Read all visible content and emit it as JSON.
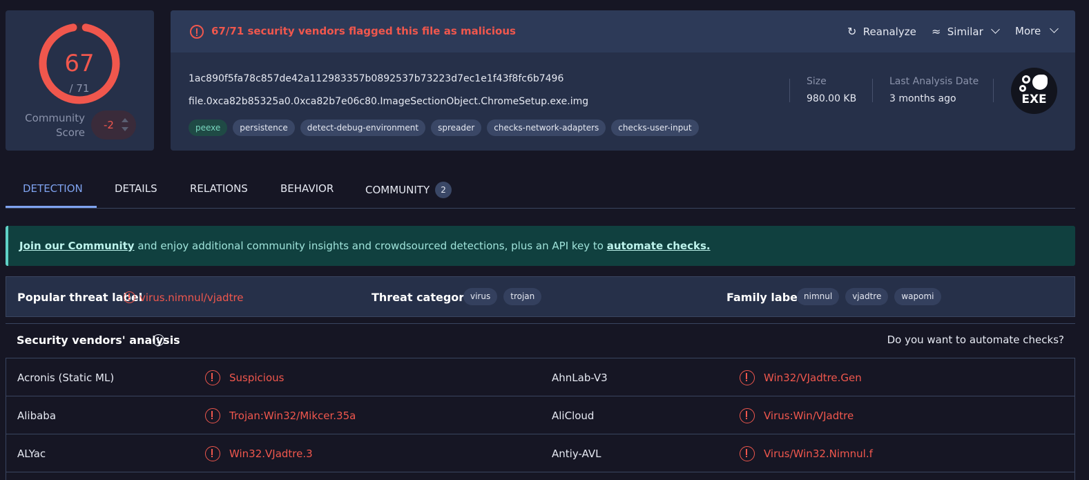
{
  "score": {
    "detected": "67",
    "total": "/ 71",
    "fraction": 0.944,
    "color": "#f0574d"
  },
  "community": {
    "label_line1": "Community",
    "label_line2": "Score",
    "value": "-2"
  },
  "file": {
    "alert": "67/71 security vendors flagged this file as malicious",
    "hash": "1ac890f5fa78c857de42a112983357b0892537b73223d7ec1e1f43f8fc6b7496",
    "name": "file.0xca82b85325a0.0xca82b7e06c80.ImageSectionObject.ChromeSetup.exe.img",
    "tags": [
      "peexe",
      "persistence",
      "detect-debug-environment",
      "spreader",
      "checks-network-adapters",
      "checks-user-input"
    ],
    "size_label": "Size",
    "size_value": "980.00 KB",
    "date_label": "Last Analysis Date",
    "date_value": "3 months ago",
    "type_badge": "EXE"
  },
  "actions": {
    "reanalyze": "Reanalyze",
    "similar": "Similar",
    "more": "More"
  },
  "tabs": [
    "DETECTION",
    "DETAILS",
    "RELATIONS",
    "BEHAVIOR",
    "COMMUNITY"
  ],
  "tab_community_count": "2",
  "banner": {
    "link1": "Join our Community",
    "middle": " and enjoy additional community insights and crowdsourced detections, plus an API key to ",
    "link2": "automate checks."
  },
  "labels": {
    "popular_title": "Popular threat label",
    "popular_value": "virus.nimnul/vjadtre",
    "categories_title": "Threat categories",
    "categories": [
      "virus",
      "trojan"
    ],
    "family_title": "Family labels",
    "families": [
      "nimnul",
      "vjadtre",
      "wapomi"
    ]
  },
  "vendors_header": {
    "title": "Security vendors' analysis",
    "automate": "Do you want to automate checks?"
  },
  "vendors": [
    {
      "left_name": "Acronis (Static ML)",
      "left_result": "Suspicious",
      "right_name": "AhnLab-V3",
      "right_result": "Win32/VJadtre.Gen"
    },
    {
      "left_name": "Alibaba",
      "left_result": "Trojan:Win32/Mikcer.35a",
      "right_name": "AliCloud",
      "right_result": "Virus:Win/VJadtre"
    },
    {
      "left_name": "ALYac",
      "left_result": "Win32.VJadtre.3",
      "right_name": "Antiy-AVL",
      "right_result": "Virus/Win32.Nimnul.f"
    }
  ]
}
